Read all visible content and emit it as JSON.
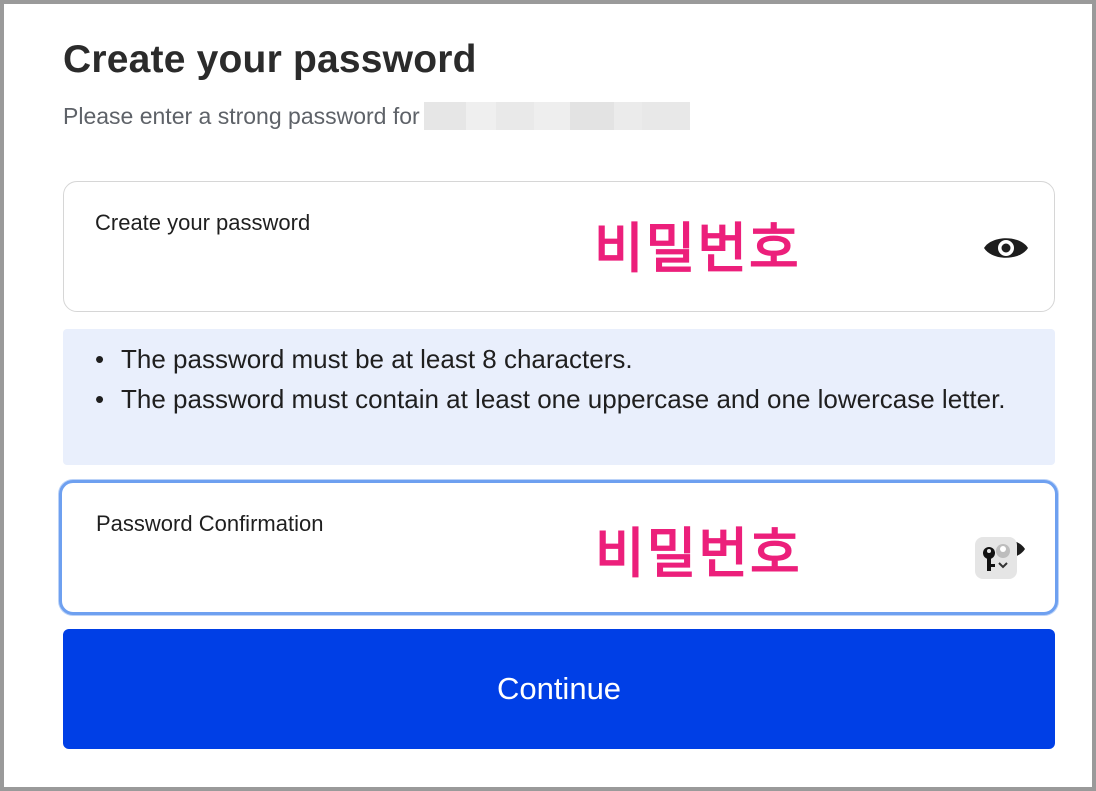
{
  "page": {
    "title": "Create your password",
    "subtitle": "Please enter a strong password for"
  },
  "password_field": {
    "label": "Create your password",
    "value": "비밀번호",
    "toggle_icon": "eye-icon"
  },
  "requirements": [
    "The password must be at least 8 characters.",
    "The password must contain at least one uppercase and one lowercase letter."
  ],
  "confirm_field": {
    "label": "Password Confirmation",
    "value": "비밀번호",
    "toggle_icon": "eye-icon",
    "autofill_icon": "keychain-icon"
  },
  "actions": {
    "continue_label": "Continue"
  },
  "colors": {
    "primary_button": "#003fe6",
    "annotation_text": "#ec1f7b",
    "requirements_bg": "#e9effc",
    "focus_ring": "#6ea0f0"
  }
}
